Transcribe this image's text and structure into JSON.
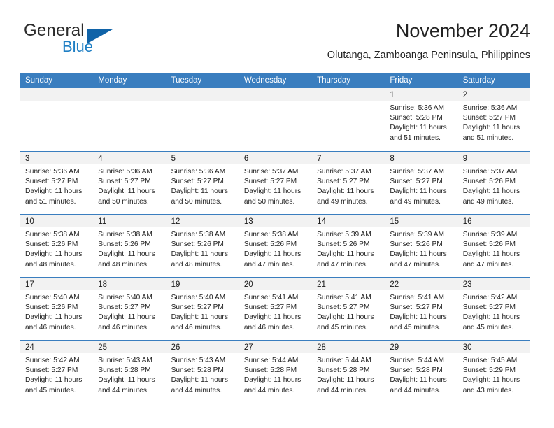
{
  "brand": {
    "word_one": "General",
    "word_two": "Blue",
    "triangle_icon": "blue-triangle-logo"
  },
  "header": {
    "title": "November 2024",
    "subtitle": "Olutanga, Zamboanga Peninsula, Philippines"
  },
  "colors": {
    "header_band": "#3a7ebf",
    "day_head": "#f2f2f2",
    "brand_blue": "#1f7fc4",
    "logo_blue": "#1063a8"
  },
  "weekdays": [
    "Sunday",
    "Monday",
    "Tuesday",
    "Wednesday",
    "Thursday",
    "Friday",
    "Saturday"
  ],
  "weeks": [
    [
      {
        "day": "",
        "lines": []
      },
      {
        "day": "",
        "lines": []
      },
      {
        "day": "",
        "lines": []
      },
      {
        "day": "",
        "lines": []
      },
      {
        "day": "",
        "lines": []
      },
      {
        "day": "1",
        "lines": [
          "Sunrise: 5:36 AM",
          "Sunset: 5:28 PM",
          "Daylight: 11 hours",
          "and 51 minutes."
        ]
      },
      {
        "day": "2",
        "lines": [
          "Sunrise: 5:36 AM",
          "Sunset: 5:27 PM",
          "Daylight: 11 hours",
          "and 51 minutes."
        ]
      }
    ],
    [
      {
        "day": "3",
        "lines": [
          "Sunrise: 5:36 AM",
          "Sunset: 5:27 PM",
          "Daylight: 11 hours",
          "and 51 minutes."
        ]
      },
      {
        "day": "4",
        "lines": [
          "Sunrise: 5:36 AM",
          "Sunset: 5:27 PM",
          "Daylight: 11 hours",
          "and 50 minutes."
        ]
      },
      {
        "day": "5",
        "lines": [
          "Sunrise: 5:36 AM",
          "Sunset: 5:27 PM",
          "Daylight: 11 hours",
          "and 50 minutes."
        ]
      },
      {
        "day": "6",
        "lines": [
          "Sunrise: 5:37 AM",
          "Sunset: 5:27 PM",
          "Daylight: 11 hours",
          "and 50 minutes."
        ]
      },
      {
        "day": "7",
        "lines": [
          "Sunrise: 5:37 AM",
          "Sunset: 5:27 PM",
          "Daylight: 11 hours",
          "and 49 minutes."
        ]
      },
      {
        "day": "8",
        "lines": [
          "Sunrise: 5:37 AM",
          "Sunset: 5:27 PM",
          "Daylight: 11 hours",
          "and 49 minutes."
        ]
      },
      {
        "day": "9",
        "lines": [
          "Sunrise: 5:37 AM",
          "Sunset: 5:26 PM",
          "Daylight: 11 hours",
          "and 49 minutes."
        ]
      }
    ],
    [
      {
        "day": "10",
        "lines": [
          "Sunrise: 5:38 AM",
          "Sunset: 5:26 PM",
          "Daylight: 11 hours",
          "and 48 minutes."
        ]
      },
      {
        "day": "11",
        "lines": [
          "Sunrise: 5:38 AM",
          "Sunset: 5:26 PM",
          "Daylight: 11 hours",
          "and 48 minutes."
        ]
      },
      {
        "day": "12",
        "lines": [
          "Sunrise: 5:38 AM",
          "Sunset: 5:26 PM",
          "Daylight: 11 hours",
          "and 48 minutes."
        ]
      },
      {
        "day": "13",
        "lines": [
          "Sunrise: 5:38 AM",
          "Sunset: 5:26 PM",
          "Daylight: 11 hours",
          "and 47 minutes."
        ]
      },
      {
        "day": "14",
        "lines": [
          "Sunrise: 5:39 AM",
          "Sunset: 5:26 PM",
          "Daylight: 11 hours",
          "and 47 minutes."
        ]
      },
      {
        "day": "15",
        "lines": [
          "Sunrise: 5:39 AM",
          "Sunset: 5:26 PM",
          "Daylight: 11 hours",
          "and 47 minutes."
        ]
      },
      {
        "day": "16",
        "lines": [
          "Sunrise: 5:39 AM",
          "Sunset: 5:26 PM",
          "Daylight: 11 hours",
          "and 47 minutes."
        ]
      }
    ],
    [
      {
        "day": "17",
        "lines": [
          "Sunrise: 5:40 AM",
          "Sunset: 5:26 PM",
          "Daylight: 11 hours",
          "and 46 minutes."
        ]
      },
      {
        "day": "18",
        "lines": [
          "Sunrise: 5:40 AM",
          "Sunset: 5:27 PM",
          "Daylight: 11 hours",
          "and 46 minutes."
        ]
      },
      {
        "day": "19",
        "lines": [
          "Sunrise: 5:40 AM",
          "Sunset: 5:27 PM",
          "Daylight: 11 hours",
          "and 46 minutes."
        ]
      },
      {
        "day": "20",
        "lines": [
          "Sunrise: 5:41 AM",
          "Sunset: 5:27 PM",
          "Daylight: 11 hours",
          "and 46 minutes."
        ]
      },
      {
        "day": "21",
        "lines": [
          "Sunrise: 5:41 AM",
          "Sunset: 5:27 PM",
          "Daylight: 11 hours",
          "and 45 minutes."
        ]
      },
      {
        "day": "22",
        "lines": [
          "Sunrise: 5:41 AM",
          "Sunset: 5:27 PM",
          "Daylight: 11 hours",
          "and 45 minutes."
        ]
      },
      {
        "day": "23",
        "lines": [
          "Sunrise: 5:42 AM",
          "Sunset: 5:27 PM",
          "Daylight: 11 hours",
          "and 45 minutes."
        ]
      }
    ],
    [
      {
        "day": "24",
        "lines": [
          "Sunrise: 5:42 AM",
          "Sunset: 5:27 PM",
          "Daylight: 11 hours",
          "and 45 minutes."
        ]
      },
      {
        "day": "25",
        "lines": [
          "Sunrise: 5:43 AM",
          "Sunset: 5:28 PM",
          "Daylight: 11 hours",
          "and 44 minutes."
        ]
      },
      {
        "day": "26",
        "lines": [
          "Sunrise: 5:43 AM",
          "Sunset: 5:28 PM",
          "Daylight: 11 hours",
          "and 44 minutes."
        ]
      },
      {
        "day": "27",
        "lines": [
          "Sunrise: 5:44 AM",
          "Sunset: 5:28 PM",
          "Daylight: 11 hours",
          "and 44 minutes."
        ]
      },
      {
        "day": "28",
        "lines": [
          "Sunrise: 5:44 AM",
          "Sunset: 5:28 PM",
          "Daylight: 11 hours",
          "and 44 minutes."
        ]
      },
      {
        "day": "29",
        "lines": [
          "Sunrise: 5:44 AM",
          "Sunset: 5:28 PM",
          "Daylight: 11 hours",
          "and 44 minutes."
        ]
      },
      {
        "day": "30",
        "lines": [
          "Sunrise: 5:45 AM",
          "Sunset: 5:29 PM",
          "Daylight: 11 hours",
          "and 43 minutes."
        ]
      }
    ]
  ]
}
